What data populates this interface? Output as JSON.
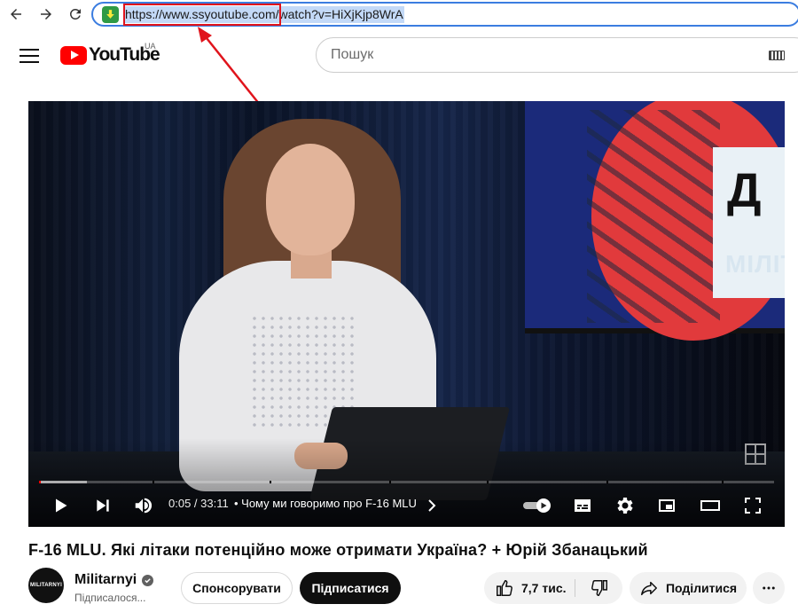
{
  "browser": {
    "url": "https://www.ssyoutube.com/watch?v=HiXjKjp8WrA"
  },
  "header": {
    "logo_text": "YouTube",
    "region": "UA",
    "search_placeholder": "Пошук"
  },
  "player": {
    "time": "0:05 / 33:11",
    "chapter": "• Чому ми говоримо про F-16 MLU",
    "played_fraction": 0.0025,
    "buffered_fraction": 0.065,
    "screen_letter": "Д",
    "screen_text": "МІЛІТ"
  },
  "video": {
    "title": "F-16 MLU. Які літаки потенційно може отримати Україна? + Юрій Збанацький"
  },
  "channel": {
    "name": "Militarnyi",
    "avatar_text": "MILITARNYI",
    "subscribed": "Підписалося..."
  },
  "actions": {
    "sponsor": "Спонсорувати",
    "subscribe": "Підписатися",
    "likes": "7,7 тис.",
    "share": "Поділитися"
  },
  "colors": {
    "accent": "#ff0000",
    "annotation": "#e0141c",
    "address_border": "#3b7de0"
  }
}
